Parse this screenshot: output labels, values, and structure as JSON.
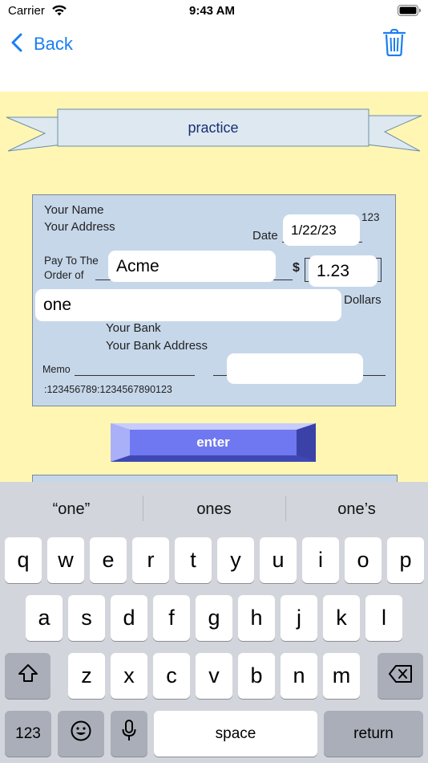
{
  "status_bar": {
    "carrier": "Carrier",
    "time": "9:43 AM"
  },
  "nav": {
    "back_label": "Back"
  },
  "banner": {
    "title": "practice"
  },
  "check": {
    "name": "Your Name",
    "address": "Your Address",
    "number": "123",
    "date_label": "Date",
    "date_value": "1/22/23",
    "pay_to_line1": "Pay To The",
    "pay_to_line2": "Order of",
    "payee_value": "Acme",
    "dollar_sign": "$",
    "amount_value": "1.23",
    "written_amount_value": "one",
    "dollars_label": "Dollars",
    "bank_name": "Your Bank",
    "bank_address": "Your Bank Address",
    "memo_label": "Memo",
    "signature_value": "",
    "routing": ":123456789:1234567890123"
  },
  "enter_button": {
    "label": "enter",
    "color": "#6f78f0"
  },
  "keyboard": {
    "suggestions": [
      "“one”",
      "ones",
      "one’s"
    ],
    "row1": [
      "q",
      "w",
      "e",
      "r",
      "t",
      "y",
      "u",
      "i",
      "o",
      "p"
    ],
    "row2": [
      "a",
      "s",
      "d",
      "f",
      "g",
      "h",
      "j",
      "k",
      "l"
    ],
    "row3": [
      "z",
      "x",
      "c",
      "v",
      "b",
      "n",
      "m"
    ],
    "numbers_label": "123",
    "space_label": "space",
    "return_label": "return"
  },
  "colors": {
    "accent": "#1a7ef0",
    "background_yellow": "#fff6b3",
    "check_blue": "#c6d7ea"
  }
}
